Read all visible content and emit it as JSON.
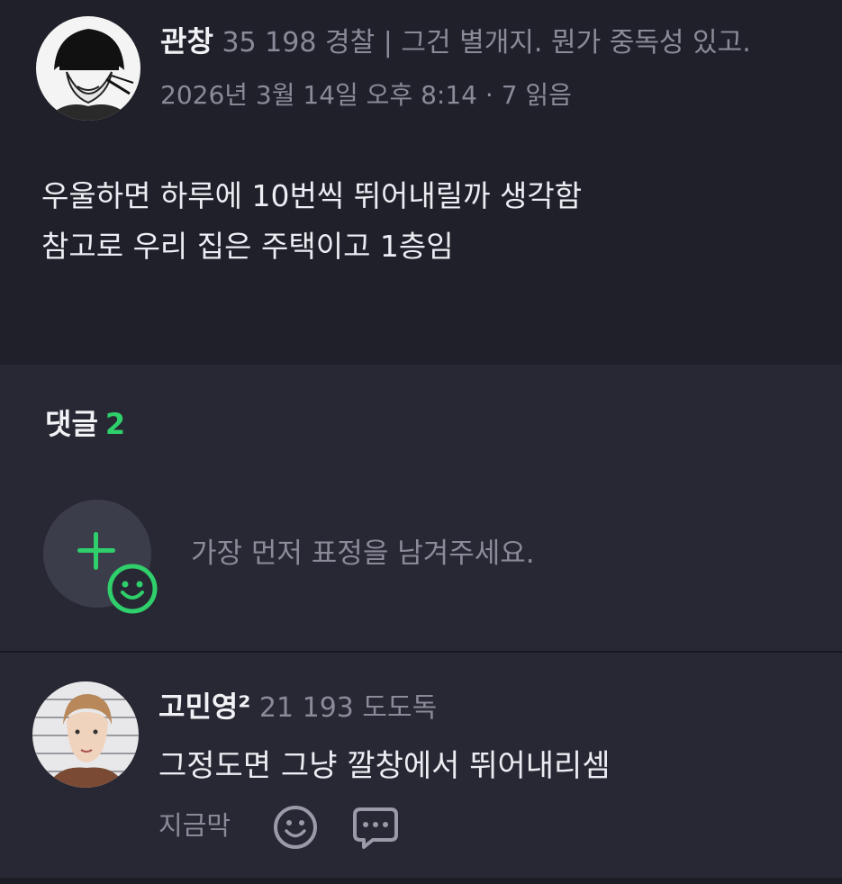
{
  "post": {
    "author": {
      "name": "관창",
      "points": "35 198",
      "rank": "경찰",
      "separator": "|",
      "bio": "그건 별개지. 뭔가 중독성 있고."
    },
    "meta": {
      "date": "2026년 3월 14일 오후 8:14",
      "dot": "·",
      "reads": "7 읽음"
    },
    "body": {
      "line1": "우울하면 하루에 10번씩 뛰어내릴까 생각함",
      "line2": "참고로 우리 집은 주택이고 1층임"
    }
  },
  "comments": {
    "title": "댓글",
    "count": "2",
    "emoji_hint": "가장 먼저 표정을 남겨주세요.",
    "items": [
      {
        "author": "고민영²",
        "points": "21 193",
        "rank": "도도독",
        "text": "그정도면 그냥 깔창에서 뛰어내리셈",
        "time": "지금막"
      }
    ]
  },
  "colors": {
    "background": "#1f2029",
    "comment_panel": "#272833",
    "accent_green": "#2fcf6b",
    "muted_text": "#8a8b98"
  },
  "icons": {
    "add_reaction": "plus-icon",
    "reaction_smile": "smile-icon",
    "comment_reaction": "smile-icon",
    "comment_reply": "chat-bubble-icon"
  }
}
